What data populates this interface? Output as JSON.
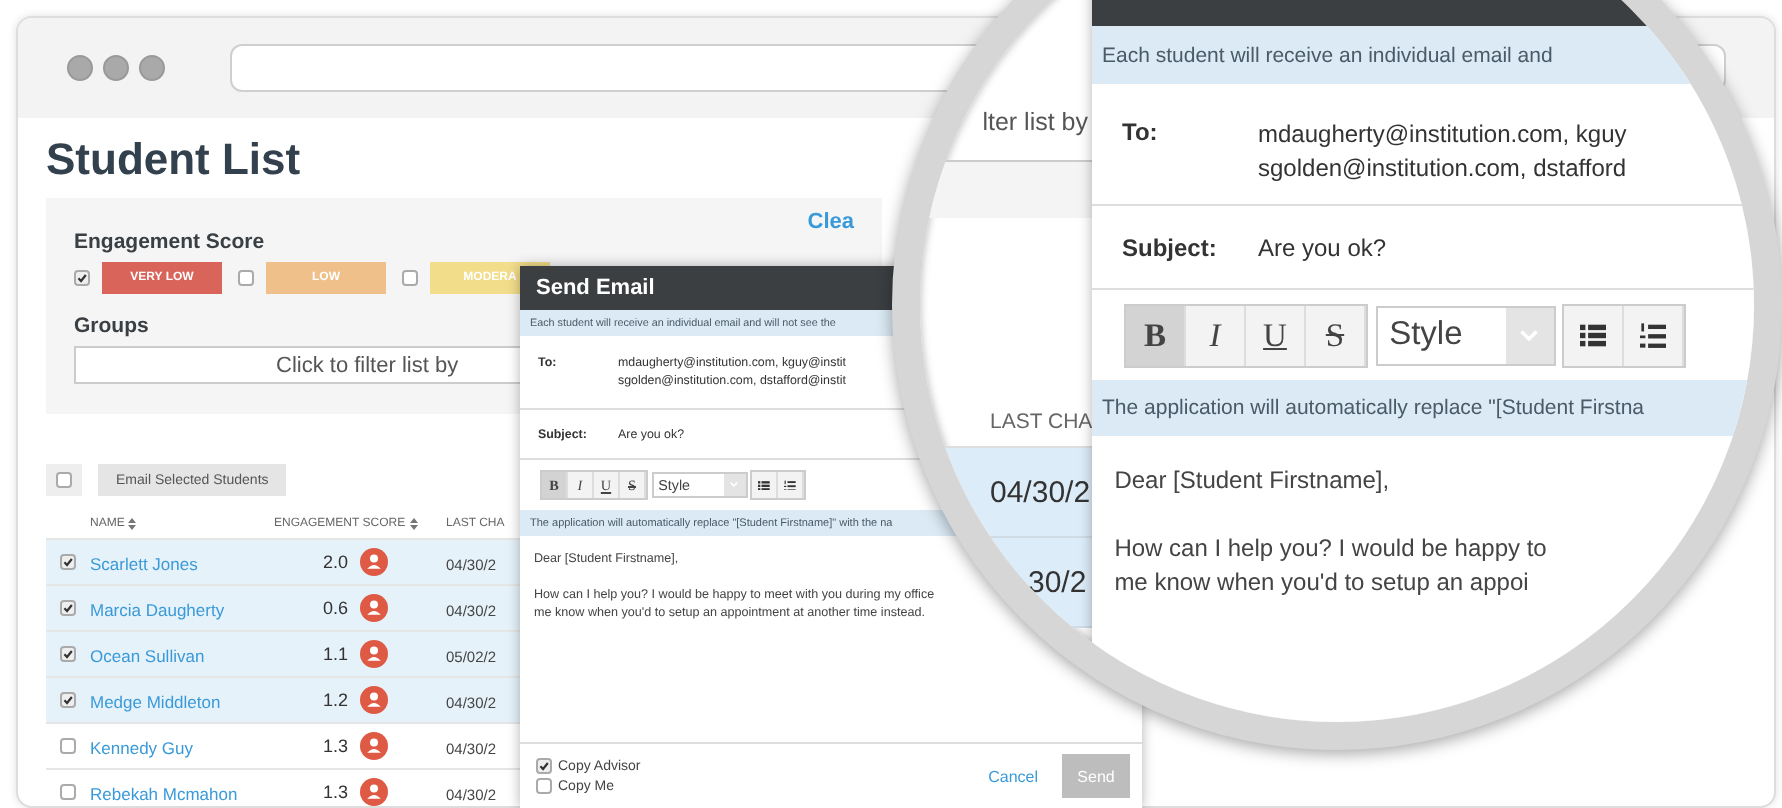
{
  "page": {
    "title": "Student List",
    "clear_link": "Clea",
    "engagement": {
      "label": "Engagement Score",
      "levels": [
        {
          "label": "VERY LOW",
          "checked": true,
          "color": "#d9645a"
        },
        {
          "label": "LOW",
          "checked": false,
          "color": "#efc089"
        },
        {
          "label": "MODERA",
          "checked": false,
          "color": "#f2dd8a"
        }
      ]
    },
    "groups": {
      "label": "Groups",
      "prompt": "Click to filter list by"
    },
    "select_all": {
      "checked": false
    },
    "email_button": "Email Selected Students",
    "table": {
      "columns": [
        {
          "label": "NAME",
          "sortable": true
        },
        {
          "label": "ENGAGEMENT SCORE",
          "sortable": true
        },
        {
          "label": "LAST CHA",
          "sortable": false
        }
      ],
      "rows": [
        {
          "name": "Scarlett Jones",
          "score": "2.0",
          "date": "04/30/2",
          "checked": true
        },
        {
          "name": "Marcia Daugherty",
          "score": "0.6",
          "date": "04/30/2",
          "checked": true
        },
        {
          "name": "Ocean Sullivan",
          "score": "1.1",
          "date": "05/02/2",
          "checked": true
        },
        {
          "name": "Medge Middleton",
          "score": "1.2",
          "date": "04/30/2",
          "checked": true
        },
        {
          "name": "Kennedy Guy",
          "score": "1.3",
          "date": "04/30/2",
          "checked": false
        },
        {
          "name": "Rebekah Mcmahon",
          "score": "1.3",
          "date": "04/30/2",
          "checked": false
        }
      ]
    }
  },
  "send_email_dialog": {
    "title": "Send Email",
    "notice": "Each student will receive an individual email and will not see the",
    "to_label": "To:",
    "recipients": [
      "mdaugherty@institution.com, kguy@instit",
      "sgolden@institution.com, dstafford@instit"
    ],
    "subject_label": "Subject:",
    "subject": "Are you ok?",
    "format_buttons": [
      {
        "label": "B",
        "kind": "bold",
        "selected": true
      },
      {
        "label": "I",
        "kind": "italic",
        "selected": false
      },
      {
        "label": "U",
        "kind": "underline",
        "selected": false
      },
      {
        "label": "S",
        "kind": "strike",
        "selected": false
      }
    ],
    "style_select": "Style",
    "replace_notice": "The application will automatically replace \"[Student Firstname]\" with the na",
    "body": [
      "Dear [Student Firstname],",
      "How can I help you? I would be happy to meet with you during my office",
      "me know when you'd to setup an appointment at another time instead."
    ],
    "options": [
      {
        "label": "Copy Advisor",
        "checked": true
      },
      {
        "label": "Copy Me",
        "checked": false
      }
    ],
    "cancel": "Cancel",
    "send": {
      "label": "Send",
      "disabled": true
    }
  },
  "magnifier": {
    "page": {
      "filter_text": "lter list by",
      "column": "LAST CHA",
      "dates": [
        "04/30/2",
        "30/2"
      ]
    },
    "dialog": {
      "notice": "Each student will receive an individual email and",
      "to_label": "To:",
      "recipients": [
        "mdaugherty@institution.com, kguy",
        "sgolden@institution.com, dstafford"
      ],
      "subject_label": "Subject:",
      "subject": "Are you ok?",
      "format_buttons": [
        {
          "label": "B",
          "kind": "bold",
          "selected": true
        },
        {
          "label": "I",
          "kind": "italic",
          "selected": false
        },
        {
          "label": "U",
          "kind": "underline",
          "selected": false
        },
        {
          "label": "S",
          "kind": "strike",
          "selected": false
        }
      ],
      "style_select": "Style",
      "replace_notice": "The application will automatically replace \"[Student Firstna",
      "body": [
        "Dear [Student Firstname],",
        "How can I help you? I would be happy to",
        "me know when you'd to setup an appoi"
      ]
    }
  }
}
